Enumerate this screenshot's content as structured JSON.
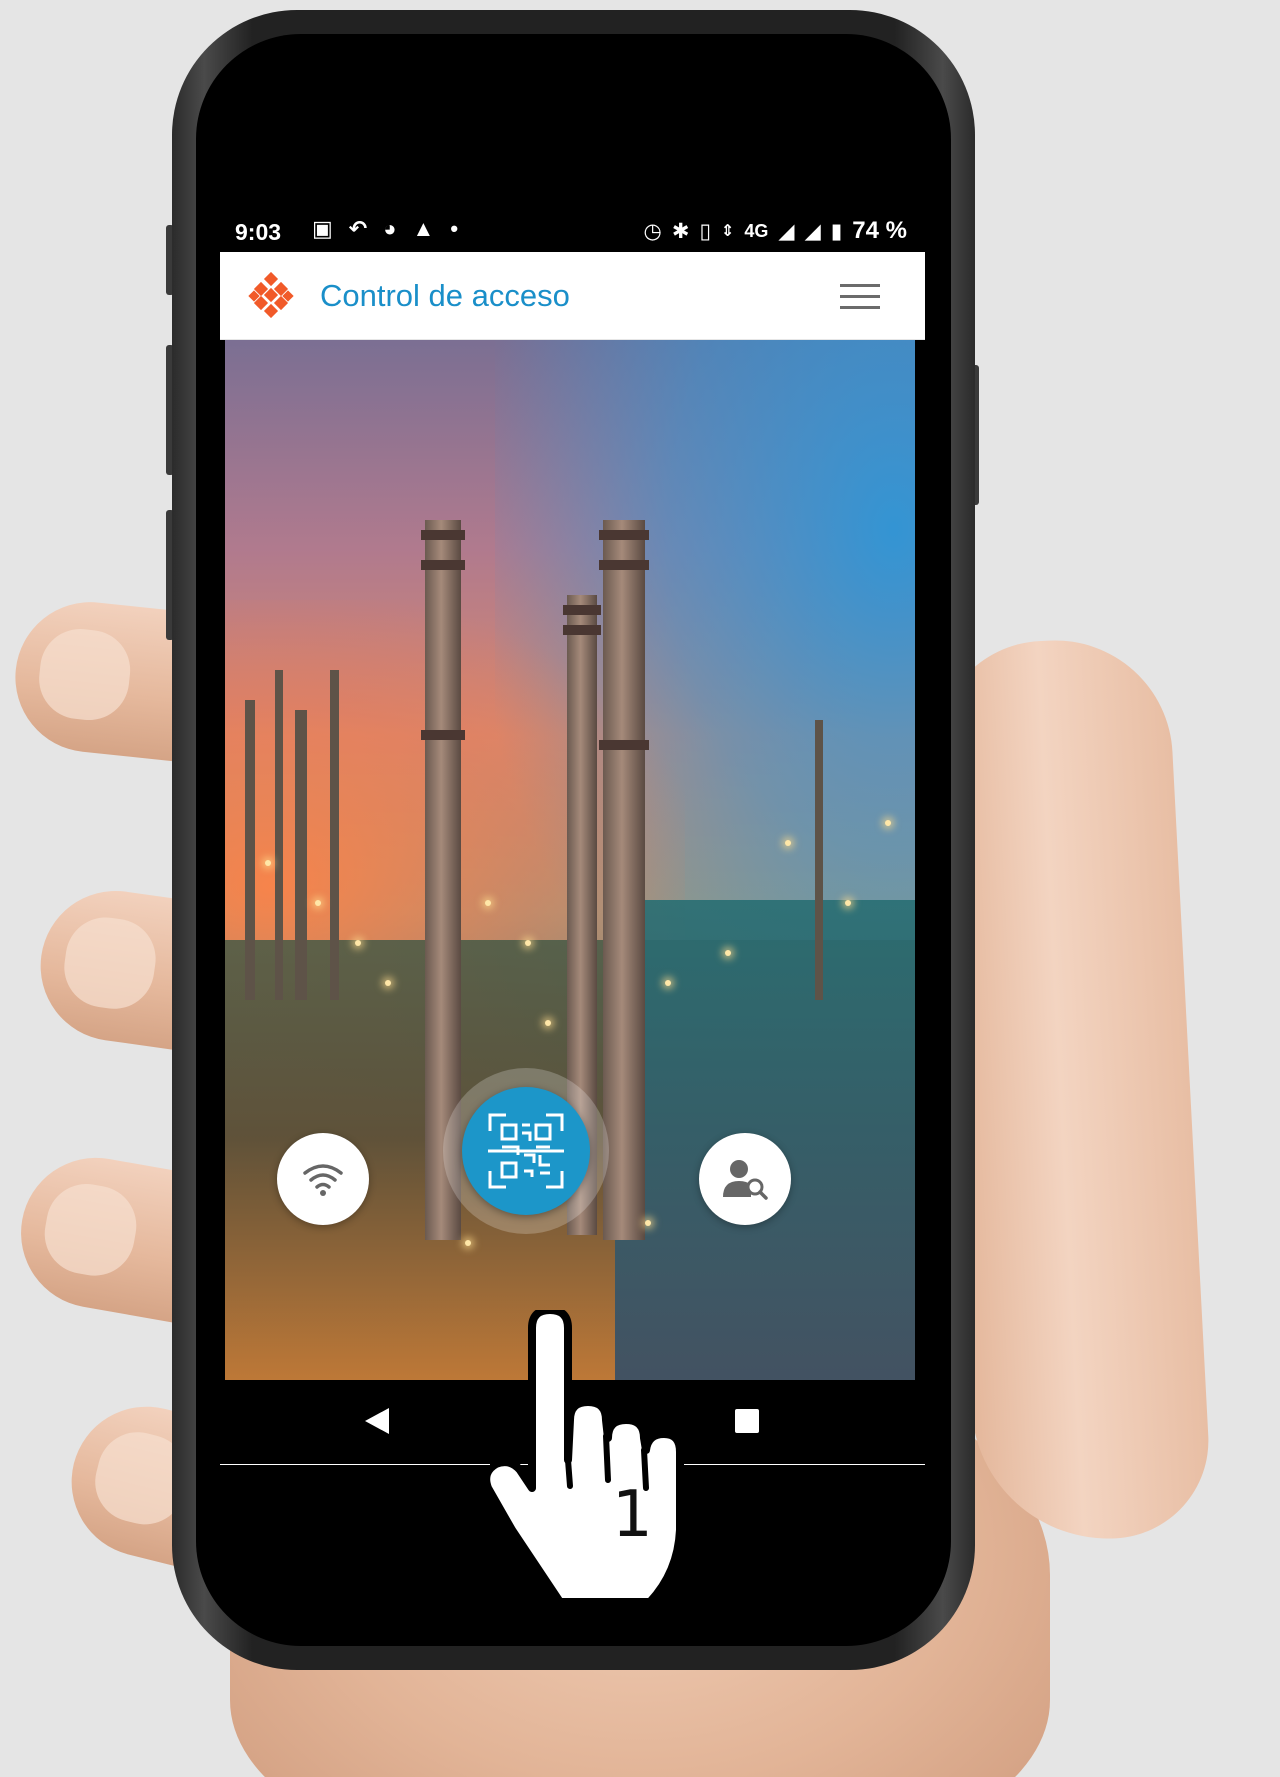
{
  "status_bar": {
    "time": "9:03",
    "network": "4G",
    "battery": "74 %",
    "left_icons": [
      "image-icon",
      "missed-call-icon",
      "clock-circle-icon",
      "drive-icon",
      "dot-icon"
    ],
    "right_icons": [
      "alarm-icon",
      "bluetooth-icon",
      "vibrate-icon",
      "data-arrows-icon",
      "signal-icon",
      "signal-icon",
      "battery-icon"
    ]
  },
  "app_bar": {
    "title": "Control de acceso",
    "logo_icon": "diamond-logo-icon",
    "menu_icon": "hamburger-menu-icon"
  },
  "actions": {
    "left_icon": "wifi-icon",
    "center_icon": "qr-scan-icon",
    "right_icon": "user-search-icon"
  },
  "nav_bar": {
    "back_icon": "back-triangle-icon",
    "recent_icon": "recent-apps-square-icon"
  },
  "overlay": {
    "step_number": "1",
    "pointer_icon": "hand-pointer-icon"
  },
  "colors": {
    "accent": "#1c96c9",
    "title": "#1a8fc9",
    "logo": "#f15a29"
  }
}
